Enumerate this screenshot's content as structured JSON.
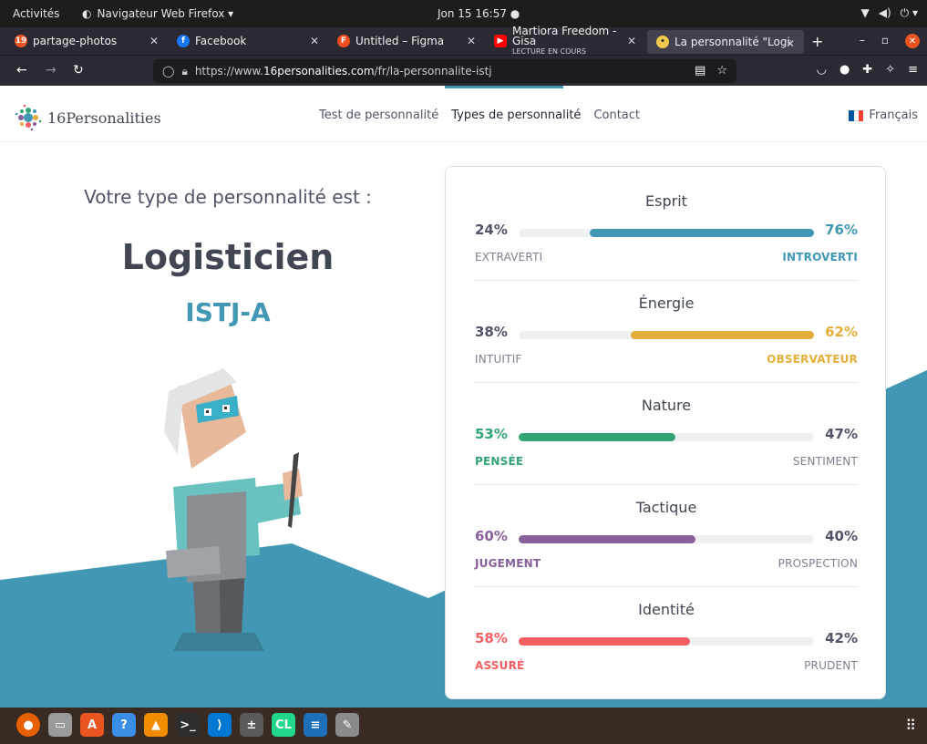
{
  "system": {
    "activities": "Activités",
    "app_menu": "Navigateur Web Firefox ▾",
    "clock": "Jon 15  16:57  ●",
    "tray": [
      "▼",
      "◀)",
      "⏻ ▾"
    ]
  },
  "tabs": [
    {
      "title": "partage-photos",
      "icon_color": "#e95420",
      "icon_text": "19"
    },
    {
      "title": "Facebook",
      "icon_color": "#1877f2",
      "icon_text": "f"
    },
    {
      "title": "Untitled – Figma",
      "icon_color": "#f24e1e",
      "icon_text": "F"
    },
    {
      "title": "Martiora Freedom - Gisa",
      "subtitle": "LECTURE EN COURS",
      "icon_color": "#ff0000",
      "icon_text": "▶"
    },
    {
      "title": "La personnalité \"Logistic",
      "icon_color": "#f2c94c",
      "icon_text": "•",
      "active": true
    }
  ],
  "nav": {
    "url_prefix": "https://www.",
    "url_domain": "16personalities.com",
    "url_path": "/fr/la-personnalite-istj"
  },
  "site": {
    "logo_text": "16Personalities",
    "menu": [
      "Test de personnalité",
      "Types de personnalité",
      "Contact"
    ],
    "language": "Français"
  },
  "hero": {
    "intro": "Votre type de personnalité est :",
    "type_name": "Logisticien",
    "type_code": "ISTJ-A"
  },
  "traits": [
    {
      "title": "Esprit",
      "left_pct": "24%",
      "right_pct": "76%",
      "left_label": "EXTRAVERTI",
      "right_label": "INTROVERTI",
      "value": 76,
      "side": "right",
      "color": "#4298b4"
    },
    {
      "title": "Énergie",
      "left_pct": "38%",
      "right_pct": "62%",
      "left_label": "INTUITIF",
      "right_label": "OBSERVATEUR",
      "value": 62,
      "side": "right",
      "color": "#e4ae3a"
    },
    {
      "title": "Nature",
      "left_pct": "53%",
      "right_pct": "47%",
      "left_label": "PENSÉE",
      "right_label": "SENTIMENT",
      "value": 53,
      "side": "left",
      "color": "#33a474"
    },
    {
      "title": "Tactique",
      "left_pct": "60%",
      "right_pct": "40%",
      "left_label": "JUGEMENT",
      "right_label": "PROSPECTION",
      "value": 60,
      "side": "left",
      "color": "#88619a"
    },
    {
      "title": "Identité",
      "left_pct": "58%",
      "right_pct": "42%",
      "left_label": "ASSURÉ",
      "right_label": "PRUDENT",
      "value": 58,
      "side": "left",
      "color": "#f25e62"
    }
  ],
  "dock": [
    {
      "name": "firefox",
      "color": "#e66000",
      "glyph": "●"
    },
    {
      "name": "files",
      "color": "#9a9a9a",
      "glyph": "▭"
    },
    {
      "name": "software",
      "color": "#e95420",
      "glyph": "A"
    },
    {
      "name": "help",
      "color": "#3b8ee6",
      "glyph": "?"
    },
    {
      "name": "vlc",
      "color": "#f08c00",
      "glyph": "▲"
    },
    {
      "name": "terminal",
      "color": "#2d2d2d",
      "glyph": ">_"
    },
    {
      "name": "vscode",
      "color": "#0078d4",
      "glyph": "⟩"
    },
    {
      "name": "calculator",
      "color": "#5a5a5a",
      "glyph": "±"
    },
    {
      "name": "clion",
      "color": "#21d789",
      "glyph": "CL"
    },
    {
      "name": "writer",
      "color": "#1d70b8",
      "glyph": "≡"
    },
    {
      "name": "text-editor",
      "color": "#8a8a8a",
      "glyph": "✎"
    }
  ]
}
